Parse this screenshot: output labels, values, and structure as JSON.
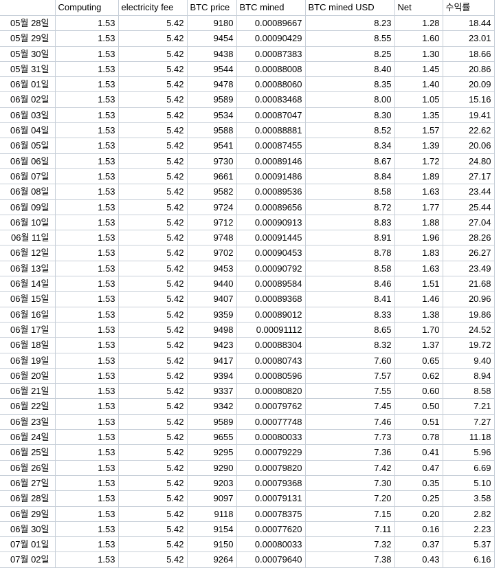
{
  "table": {
    "headers": [
      "",
      "Computing",
      "electricity fee",
      "BTC price",
      "BTC mined",
      "BTC mined USD",
      "Net",
      "수익률"
    ],
    "rows": [
      [
        "05월 28일",
        "1.53",
        "5.42",
        "9180",
        "0.00089667",
        "8.23",
        "1.28",
        "18.44"
      ],
      [
        "05월 29일",
        "1.53",
        "5.42",
        "9454",
        "0.00090429",
        "8.55",
        "1.60",
        "23.01"
      ],
      [
        "05월 30일",
        "1.53",
        "5.42",
        "9438",
        "0.00087383",
        "8.25",
        "1.30",
        "18.66"
      ],
      [
        "05월 31일",
        "1.53",
        "5.42",
        "9544",
        "0.00088008",
        "8.40",
        "1.45",
        "20.86"
      ],
      [
        "06월 01일",
        "1.53",
        "5.42",
        "9478",
        "0.00088060",
        "8.35",
        "1.40",
        "20.09"
      ],
      [
        "06월 02일",
        "1.53",
        "5.42",
        "9589",
        "0.00083468",
        "8.00",
        "1.05",
        "15.16"
      ],
      [
        "06월 03일",
        "1.53",
        "5.42",
        "9534",
        "0.00087047",
        "8.30",
        "1.35",
        "19.41"
      ],
      [
        "06월 04일",
        "1.53",
        "5.42",
        "9588",
        "0.00088881",
        "8.52",
        "1.57",
        "22.62"
      ],
      [
        "06월 05일",
        "1.53",
        "5.42",
        "9541",
        "0.00087455",
        "8.34",
        "1.39",
        "20.06"
      ],
      [
        "06월 06일",
        "1.53",
        "5.42",
        "9730",
        "0.00089146",
        "8.67",
        "1.72",
        "24.80"
      ],
      [
        "06월 07일",
        "1.53",
        "5.42",
        "9661",
        "0.00091486",
        "8.84",
        "1.89",
        "27.17"
      ],
      [
        "06월 08일",
        "1.53",
        "5.42",
        "9582",
        "0.00089536",
        "8.58",
        "1.63",
        "23.44"
      ],
      [
        "06월 09일",
        "1.53",
        "5.42",
        "9724",
        "0.00089656",
        "8.72",
        "1.77",
        "25.44"
      ],
      [
        "06월 10일",
        "1.53",
        "5.42",
        "9712",
        "0.00090913",
        "8.83",
        "1.88",
        "27.04"
      ],
      [
        "06월 11일",
        "1.53",
        "5.42",
        "9748",
        "0.00091445",
        "8.91",
        "1.96",
        "28.26"
      ],
      [
        "06월 12일",
        "1.53",
        "5.42",
        "9702",
        "0.00090453",
        "8.78",
        "1.83",
        "26.27"
      ],
      [
        "06월 13일",
        "1.53",
        "5.42",
        "9453",
        "0.00090792",
        "8.58",
        "1.63",
        "23.49"
      ],
      [
        "06월 14일",
        "1.53",
        "5.42",
        "9440",
        "0.00089584",
        "8.46",
        "1.51",
        "21.68"
      ],
      [
        "06월 15일",
        "1.53",
        "5.42",
        "9407",
        "0.00089368",
        "8.41",
        "1.46",
        "20.96"
      ],
      [
        "06월 16일",
        "1.53",
        "5.42",
        "9359",
        "0.00089012",
        "8.33",
        "1.38",
        "19.86"
      ],
      [
        "06월 17일",
        "1.53",
        "5.42",
        "9498",
        "0.00091112",
        "8.65",
        "1.70",
        "24.52"
      ],
      [
        "06월 18일",
        "1.53",
        "5.42",
        "9423",
        "0.00088304",
        "8.32",
        "1.37",
        "19.72"
      ],
      [
        "06월 19일",
        "1.53",
        "5.42",
        "9417",
        "0.00080743",
        "7.60",
        "0.65",
        "9.40"
      ],
      [
        "06월 20일",
        "1.53",
        "5.42",
        "9394",
        "0.00080596",
        "7.57",
        "0.62",
        "8.94"
      ],
      [
        "06월 21일",
        "1.53",
        "5.42",
        "9337",
        "0.00080820",
        "7.55",
        "0.60",
        "8.58"
      ],
      [
        "06월 22일",
        "1.53",
        "5.42",
        "9342",
        "0.00079762",
        "7.45",
        "0.50",
        "7.21"
      ],
      [
        "06월 23일",
        "1.53",
        "5.42",
        "9589",
        "0.00077748",
        "7.46",
        "0.51",
        "7.27"
      ],
      [
        "06월 24일",
        "1.53",
        "5.42",
        "9655",
        "0.00080033",
        "7.73",
        "0.78",
        "11.18"
      ],
      [
        "06월 25일",
        "1.53",
        "5.42",
        "9295",
        "0.00079229",
        "7.36",
        "0.41",
        "5.96"
      ],
      [
        "06월 26일",
        "1.53",
        "5.42",
        "9290",
        "0.00079820",
        "7.42",
        "0.47",
        "6.69"
      ],
      [
        "06월 27일",
        "1.53",
        "5.42",
        "9203",
        "0.00079368",
        "7.30",
        "0.35",
        "5.10"
      ],
      [
        "06월 28일",
        "1.53",
        "5.42",
        "9097",
        "0.00079131",
        "7.20",
        "0.25",
        "3.58"
      ],
      [
        "06월 29일",
        "1.53",
        "5.42",
        "9118",
        "0.00078375",
        "7.15",
        "0.20",
        "2.82"
      ],
      [
        "06월 30일",
        "1.53",
        "5.42",
        "9154",
        "0.00077620",
        "7.11",
        "0.16",
        "2.23"
      ],
      [
        "07월 01일",
        "1.53",
        "5.42",
        "9150",
        "0.00080033",
        "7.32",
        "0.37",
        "5.37"
      ],
      [
        "07월 02일",
        "1.53",
        "5.42",
        "9264",
        "0.00079640",
        "7.38",
        "0.43",
        "6.16"
      ]
    ]
  },
  "colors": {
    "gridline": "#c7cfd8",
    "text": "#000000",
    "background": "#ffffff"
  }
}
